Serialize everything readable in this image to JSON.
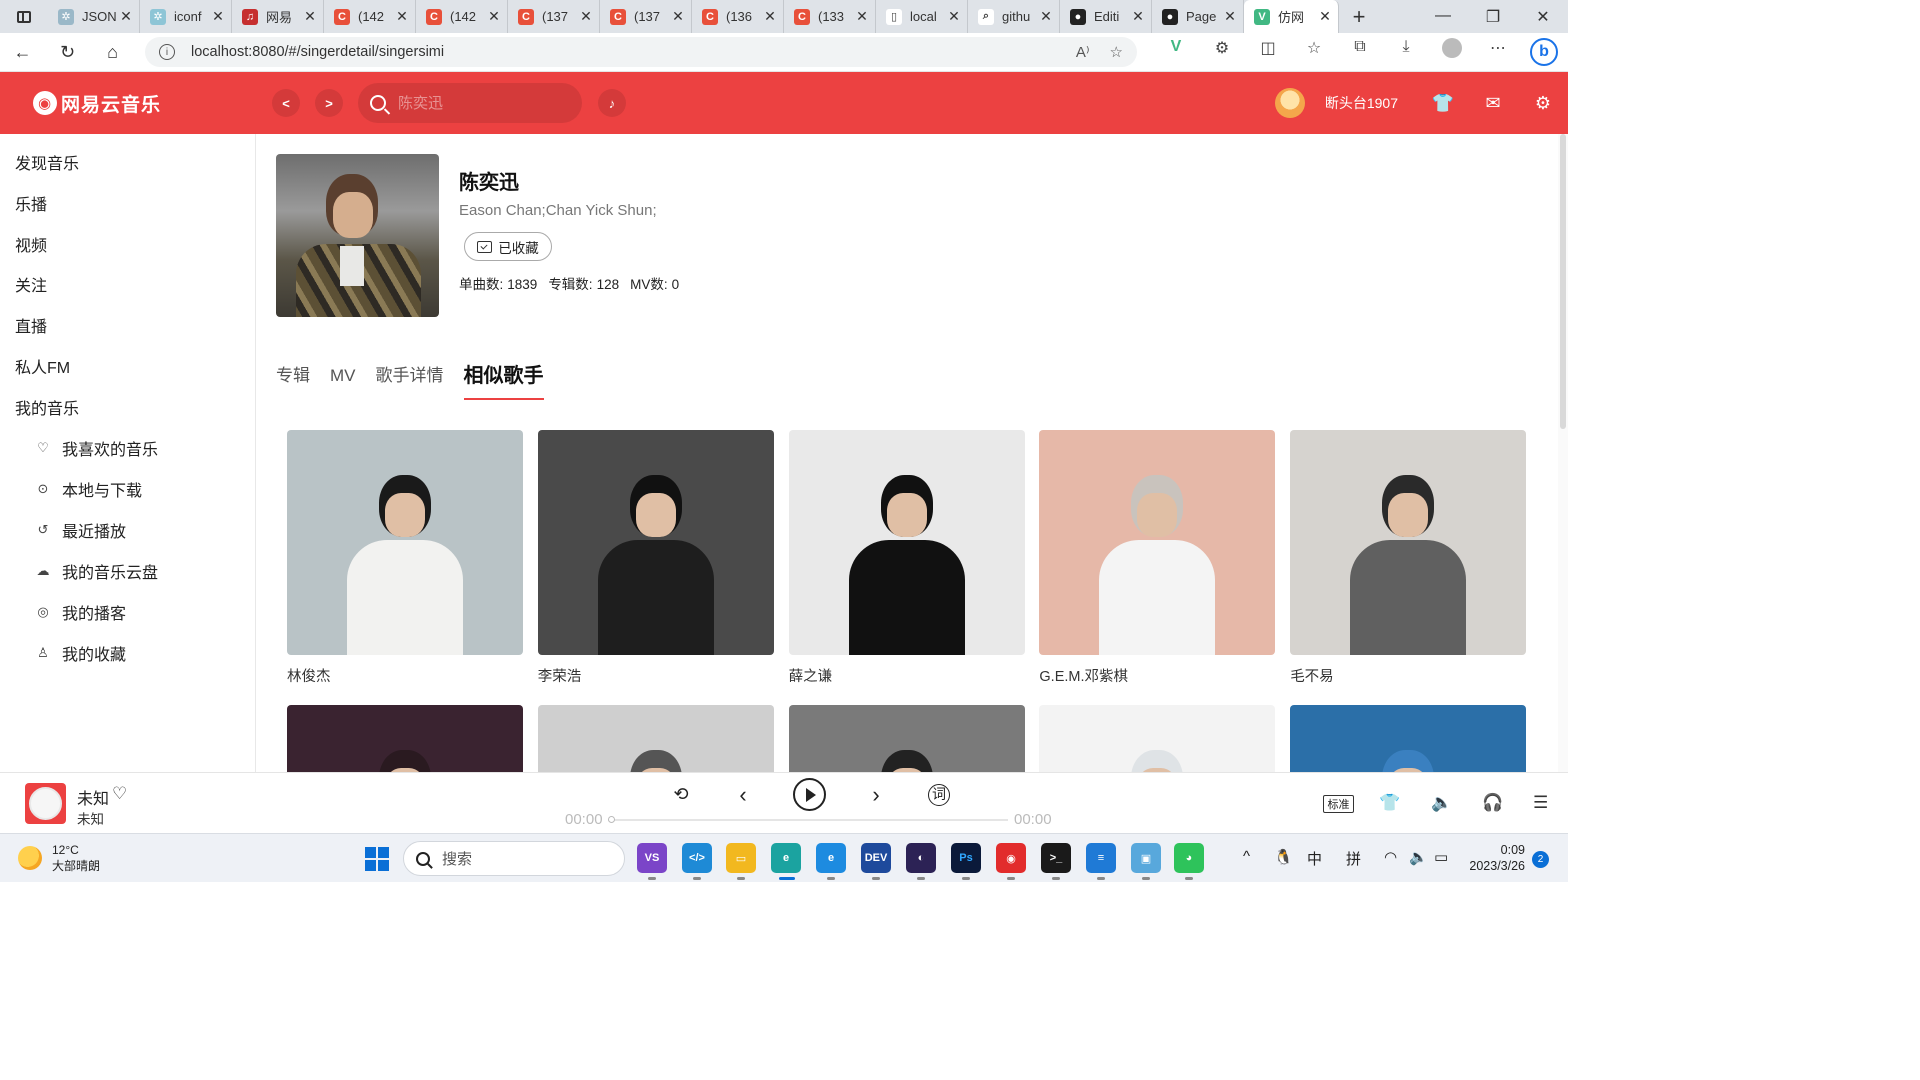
{
  "browser": {
    "tabs": [
      {
        "label": "JSON",
        "color": "#9ab8c8",
        "glyph": "✲"
      },
      {
        "label": "iconf",
        "color": "#8ec5d6",
        "glyph": "✲"
      },
      {
        "label": "网易",
        "color": "#c62f2f",
        "glyph": "♫"
      },
      {
        "label": "(142",
        "color": "#e8503a",
        "glyph": "C"
      },
      {
        "label": "(142",
        "color": "#e8503a",
        "glyph": "C"
      },
      {
        "label": "(137",
        "color": "#e8503a",
        "glyph": "C"
      },
      {
        "label": "(137",
        "color": "#e8503a",
        "glyph": "C"
      },
      {
        "label": "(136",
        "color": "#e8503a",
        "glyph": "C"
      },
      {
        "label": "(133",
        "color": "#e8503a",
        "glyph": "C"
      },
      {
        "label": "local",
        "color": "#ffffff",
        "glyph": "▯"
      },
      {
        "label": "githu",
        "color": "#ffffff",
        "glyph": "⌕"
      },
      {
        "label": "Editi",
        "color": "#222222",
        "glyph": "●"
      },
      {
        "label": "Page",
        "color": "#222222",
        "glyph": "●"
      },
      {
        "label": "仿网",
        "color": "#41b883",
        "glyph": "V"
      }
    ],
    "url": "localhost:8080/#/singerdetail/singersimi"
  },
  "app": {
    "logo": "网易云音乐",
    "search_placeholder": "陈奕迅",
    "back_label": "<",
    "forward_label": ">",
    "username": "断头台1907"
  },
  "sidebar": {
    "items": [
      "发现音乐",
      "乐播",
      "视频",
      "关注",
      "直播",
      "私人FM",
      "我的音乐"
    ],
    "subitems": [
      {
        "label": "我喜欢的音乐",
        "icon": "heart-icon"
      },
      {
        "label": "本地与下载",
        "icon": "download-icon"
      },
      {
        "label": "最近播放",
        "icon": "history-icon"
      },
      {
        "label": "我的音乐云盘",
        "icon": "cloud-icon"
      },
      {
        "label": "我的播客",
        "icon": "podcast-icon"
      },
      {
        "label": "我的收藏",
        "icon": "user-icon"
      }
    ]
  },
  "artist": {
    "name": "陈奕迅",
    "alias": "Eason Chan;Chan Yick Shun;",
    "collect_label": "已收藏",
    "stats": [
      {
        "label": "单曲数:",
        "value": "1839"
      },
      {
        "label": "专辑数:",
        "value": "128"
      },
      {
        "label": "MV数:",
        "value": "0"
      }
    ]
  },
  "tabs": [
    "专辑",
    "MV",
    "歌手详情",
    "相似歌手"
  ],
  "active_tab": "相似歌手",
  "similar_artists": [
    {
      "name": "林俊杰",
      "bg": "#b9c3c6",
      "top": "#f2f2f0",
      "hair": "#1a1a1a"
    },
    {
      "name": "李荣浩",
      "bg": "#4a4a4a",
      "top": "#1e1e1e",
      "hair": "#111111"
    },
    {
      "name": "薛之谦",
      "bg": "#e9e9e9",
      "top": "#111111",
      "hair": "#111111"
    },
    {
      "name": "G.E.M.邓紫棋",
      "bg": "#e6b8a8",
      "top": "#f4f4f4",
      "hair": "#c9c3bd"
    },
    {
      "name": "毛不易",
      "bg": "#d6d3cf",
      "top": "#606060",
      "hair": "#2a2a2a"
    },
    {
      "name": "",
      "bg": "#3a2330",
      "top": "#2a1a20",
      "hair": "#2a1a20"
    },
    {
      "name": "",
      "bg": "#cfcfcf",
      "top": "#999999",
      "hair": "#555555"
    },
    {
      "name": "",
      "bg": "#7a7a7a",
      "top": "#333333",
      "hair": "#222222"
    },
    {
      "name": "",
      "bg": "#f3f3f3",
      "top": "#e2e6ea",
      "hair": "#dfe3e6"
    },
    {
      "name": "",
      "bg": "#2b6fa8",
      "top": "#d8b8a8",
      "hair": "#3a80c0"
    }
  ],
  "player": {
    "title": "未知",
    "artist": "未知",
    "current_time": "00:00",
    "total_time": "00:00",
    "progress": 0,
    "quality": "标准"
  },
  "taskbar": {
    "temperature": "12°C",
    "weather": "大部晴朗",
    "search_placeholder": "搜索",
    "ime1": "中",
    "ime2": "拼",
    "time": "0:09",
    "date": "2023/3/26",
    "notifications": "2"
  }
}
